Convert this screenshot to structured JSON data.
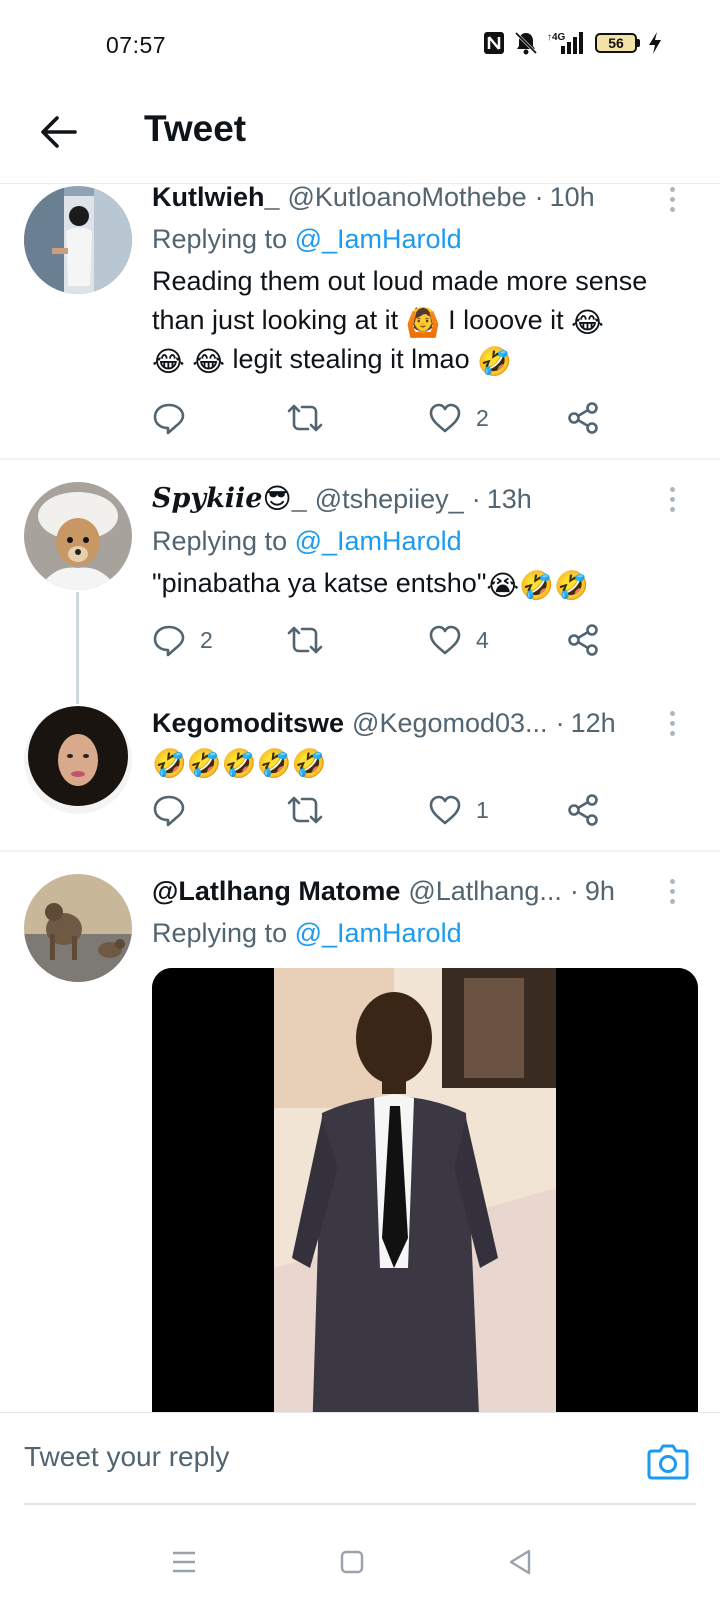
{
  "status_bar": {
    "time": "07:57",
    "network": "4G",
    "battery": "56"
  },
  "header": {
    "title": "Tweet",
    "back_icon": "arrow-left-icon"
  },
  "replies": [
    {
      "name": "Kutlwieh_",
      "handle": "@KutloanoMothebe",
      "time": "10h",
      "replying_prefix": "Replying to",
      "replying_to": "@_IamHarold",
      "text_line1": "Reading them out loud made more sense",
      "text_line2a": "than just looking at it",
      "emoji_a": "🙆",
      "text_line2b": "I looove it",
      "emoji_b": "😂",
      "emoji_c": "😂",
      "emoji_d": "😂",
      "text_line3": "legit stealing it lmao",
      "emoji_e": "🤣",
      "reply_count": "",
      "retweet_count": "",
      "like_count": "2"
    },
    {
      "name": "Spykiie",
      "name_emoji": "😎",
      "name_suffix": "_",
      "handle": "@tshepiiey_",
      "time": "13h",
      "replying_prefix": "Replying to",
      "replying_to": "@_IamHarold",
      "text": "\"pinabatha ya katse entsho\"",
      "text_emojis": "😭🤣🤣",
      "reply_count": "2",
      "retweet_count": "",
      "like_count": "4"
    },
    {
      "name": "Kegomoditswe",
      "handle": "@Kegomod03...",
      "time": "12h",
      "text_emojis": "🤣🤣🤣🤣🤣",
      "reply_count": "",
      "retweet_count": "",
      "like_count": "1"
    },
    {
      "name": "@Latlhang Matome",
      "handle": "@Latlhang...",
      "time": "9h",
      "replying_prefix": "Replying to",
      "replying_to": "@_IamHarold"
    }
  ],
  "composer": {
    "placeholder": "Tweet your reply"
  },
  "separator": "·"
}
